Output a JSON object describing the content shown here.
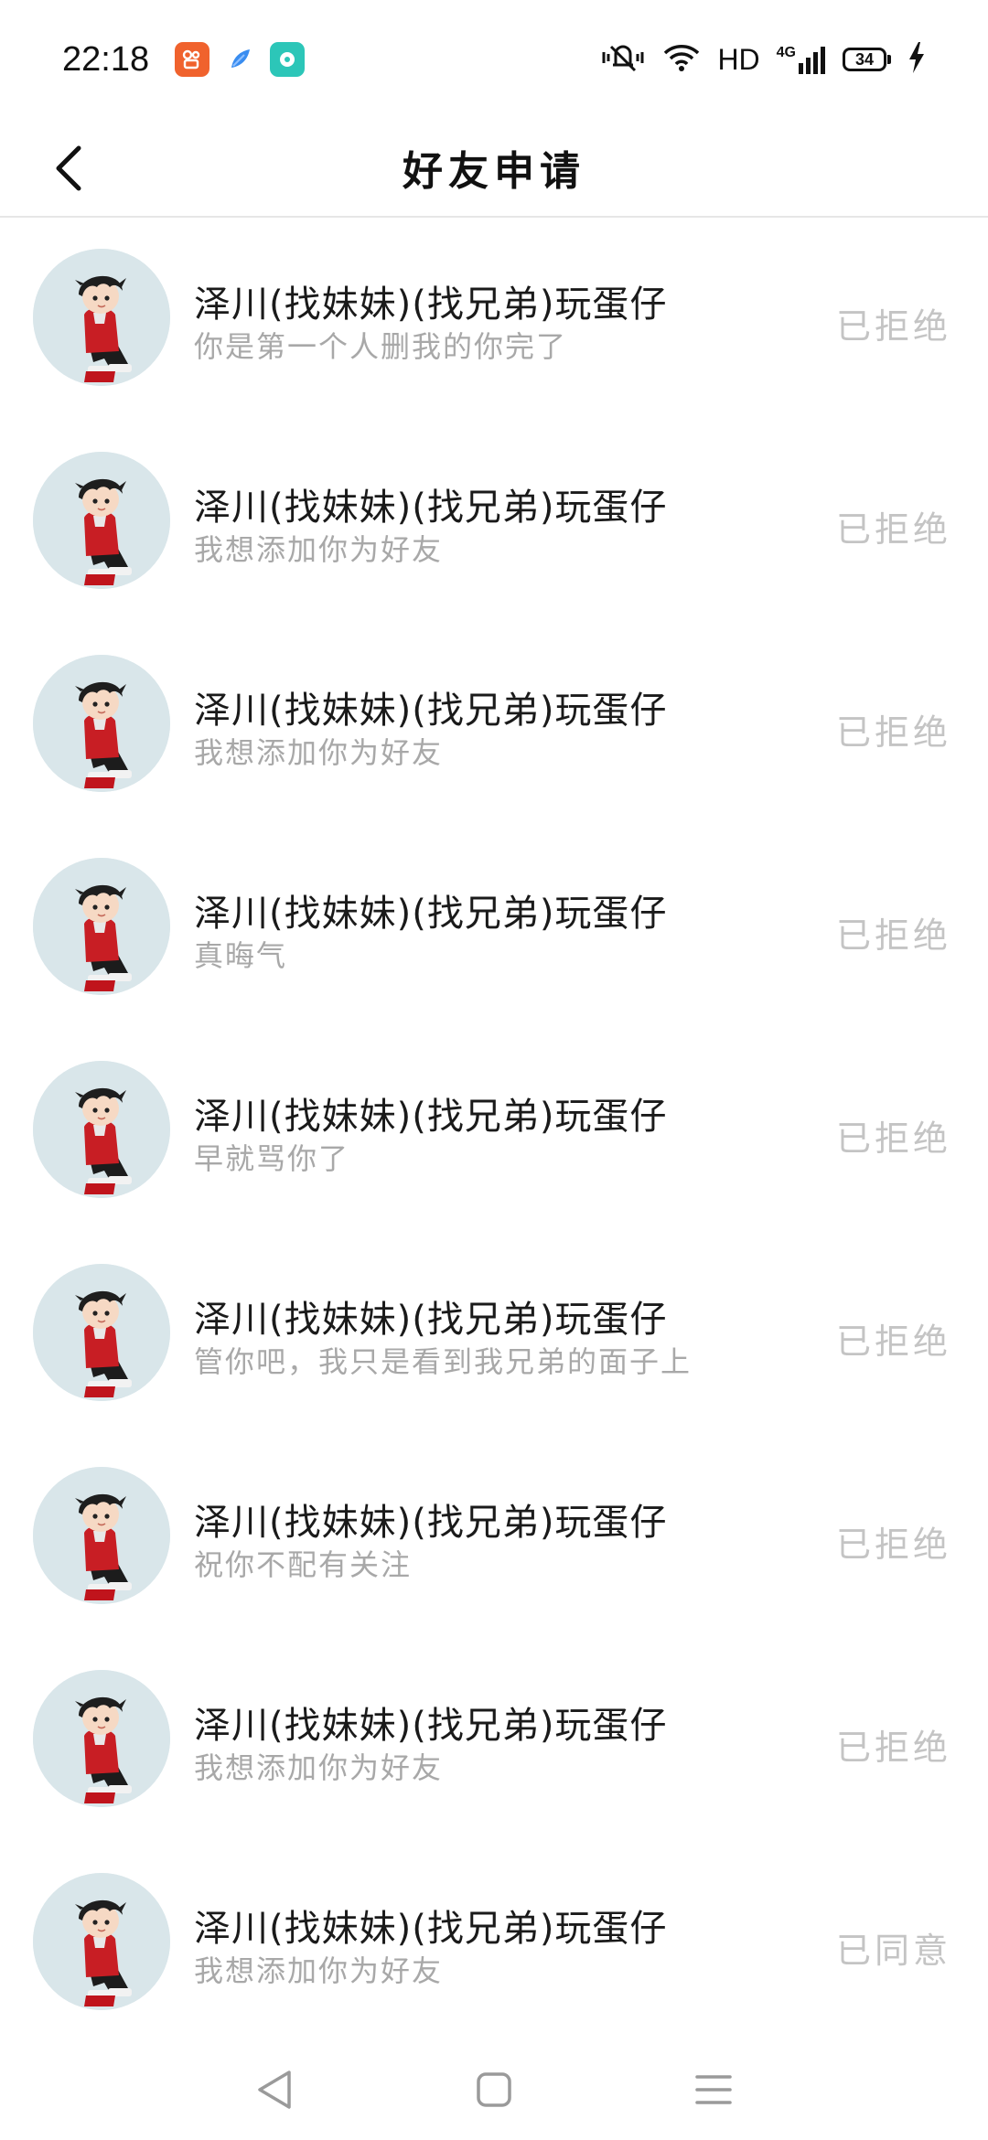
{
  "status_bar": {
    "time": "22:18",
    "network_label": "HD",
    "cell_label": "4G",
    "battery_level": "34",
    "app_badges": [
      {
        "icon": "kuaishou-icon",
        "color": "#f0622d"
      },
      {
        "icon": "feather-app-icon",
        "color": "#3a8df0"
      },
      {
        "icon": "chat-app-icon",
        "color": "#2cc6b8"
      }
    ]
  },
  "header": {
    "title": "好友申请",
    "back_icon": "chevron-left-icon"
  },
  "requests": [
    {
      "nickname": "泽川(找妹妹)(找兄弟)玩蛋仔",
      "message": "你是第一个人删我的你完了",
      "status": "已拒绝"
    },
    {
      "nickname": "泽川(找妹妹)(找兄弟)玩蛋仔",
      "message": "我想添加你为好友",
      "status": "已拒绝"
    },
    {
      "nickname": "泽川(找妹妹)(找兄弟)玩蛋仔",
      "message": "我想添加你为好友",
      "status": "已拒绝"
    },
    {
      "nickname": "泽川(找妹妹)(找兄弟)玩蛋仔",
      "message": "真晦气",
      "status": "已拒绝"
    },
    {
      "nickname": "泽川(找妹妹)(找兄弟)玩蛋仔",
      "message": "早就骂你了",
      "status": "已拒绝"
    },
    {
      "nickname": "泽川(找妹妹)(找兄弟)玩蛋仔",
      "message": "管你吧，我只是看到我兄弟的面子上",
      "status": "已拒绝"
    },
    {
      "nickname": "泽川(找妹妹)(找兄弟)玩蛋仔",
      "message": "祝你不配有关注",
      "status": "已拒绝"
    },
    {
      "nickname": "泽川(找妹妹)(找兄弟)玩蛋仔",
      "message": "我想添加你为好友",
      "status": "已拒绝"
    },
    {
      "nickname": "泽川(找妹妹)(找兄弟)玩蛋仔",
      "message": "我想添加你为好友",
      "status": "已同意"
    }
  ],
  "nav_bar": {
    "back_icon": "nav-back-triangle-icon",
    "home_icon": "nav-home-square-icon",
    "menu_icon": "nav-menu-lines-icon"
  }
}
